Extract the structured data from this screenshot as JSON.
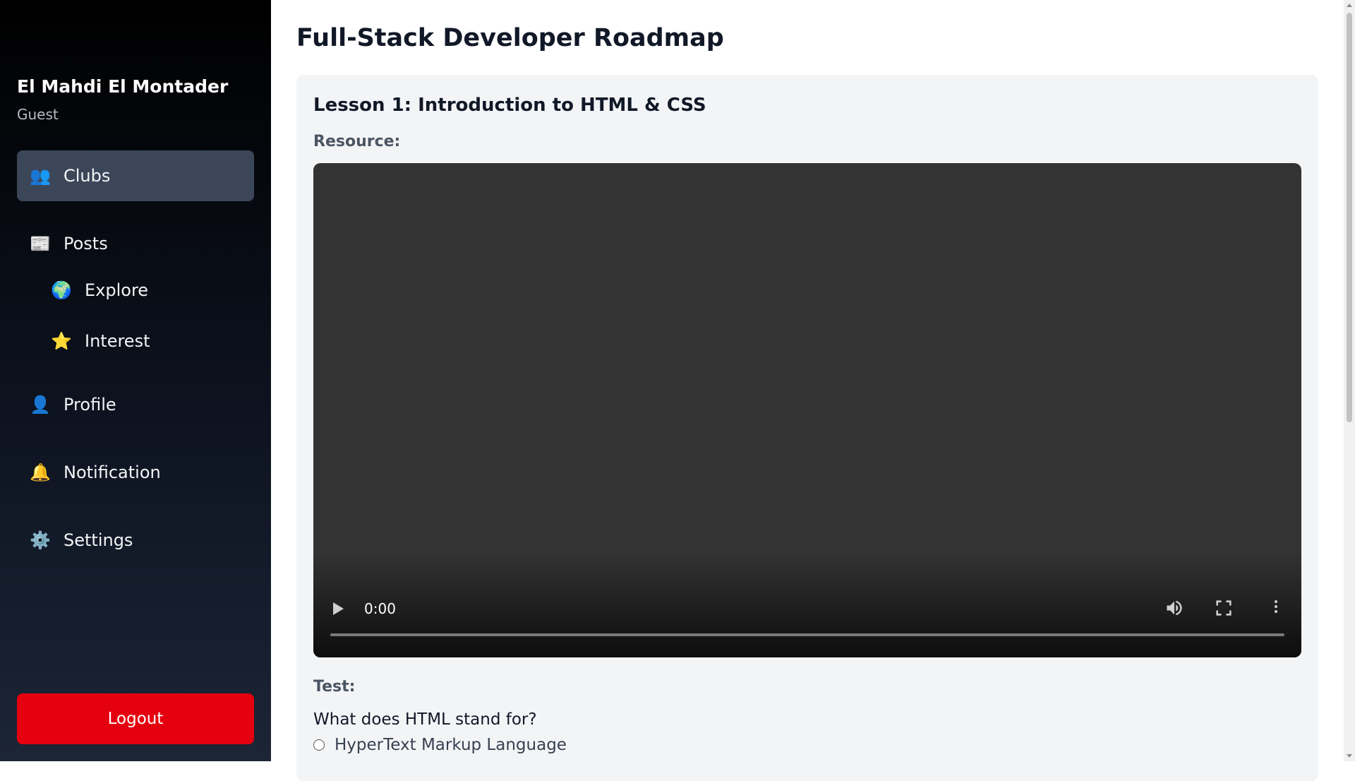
{
  "sidebar": {
    "user_name": "El Mahdi El Montader",
    "user_role": "Guest",
    "items": [
      {
        "label": "Clubs",
        "icon": "👥",
        "icon_name": "people-icon",
        "active": true
      },
      {
        "label": "Posts",
        "icon": "📰",
        "icon_name": "newspaper-icon"
      },
      {
        "label": "Explore",
        "icon": "🌍",
        "icon_name": "globe-icon"
      },
      {
        "label": "Interest",
        "icon": "⭐",
        "icon_name": "star-icon"
      },
      {
        "label": "Profile",
        "icon": "👤",
        "icon_name": "user-icon"
      },
      {
        "label": "Notification",
        "icon": "🔔",
        "icon_name": "bell-icon"
      },
      {
        "label": "Settings",
        "icon": "⚙️",
        "icon_name": "gear-icon"
      }
    ],
    "logout_label": "Logout"
  },
  "main": {
    "title": "Full-Stack Developer Roadmap",
    "lesson": {
      "title": "Lesson 1: Introduction to HTML & CSS",
      "resource_label": "Resource:",
      "video": {
        "time": "0:00",
        "progress": 0
      },
      "test_label": "Test:",
      "question": "What does HTML stand for?",
      "options": [
        "HyperText Markup Language"
      ]
    }
  },
  "colors": {
    "logout": "#e5000f",
    "active_nav": "#3b4659",
    "card_bg": "#f3f4f6",
    "video_bg": "#333333"
  }
}
